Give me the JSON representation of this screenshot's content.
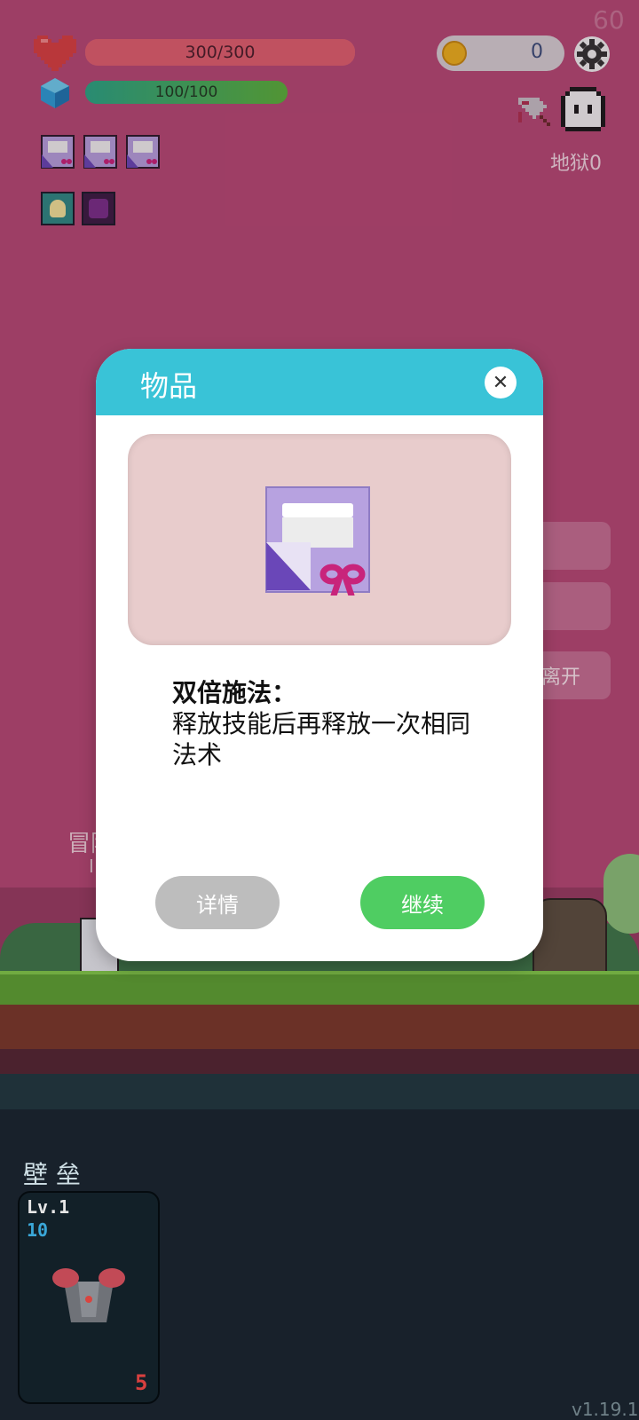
{
  "hud": {
    "fps": "60",
    "hp_text": "300/300",
    "hp_fraction": 1.0,
    "mp_text": "100/100",
    "mp_fraction": 1.0,
    "coins": "0",
    "hell_level": "地狱0",
    "hp_color": "#e2616f",
    "mp_color": "#3ab07a"
  },
  "side_menu": {
    "leave_label": "离开"
  },
  "dialog": {
    "title": "物品",
    "item_name": "双倍施法：",
    "item_desc": "释放技能后再释放一次相同法术",
    "details_label": "详情",
    "continue_label": "继续",
    "header_color": "#39c3d7",
    "continue_color": "#4fcd62"
  },
  "scene": {
    "npc_label": "冒险",
    "npc_sub": "I"
  },
  "bottom": {
    "section_title": "壁 垒",
    "card": {
      "level": "Lv.1",
      "stat": "10",
      "count": "5"
    }
  },
  "version": "v1.19.1"
}
